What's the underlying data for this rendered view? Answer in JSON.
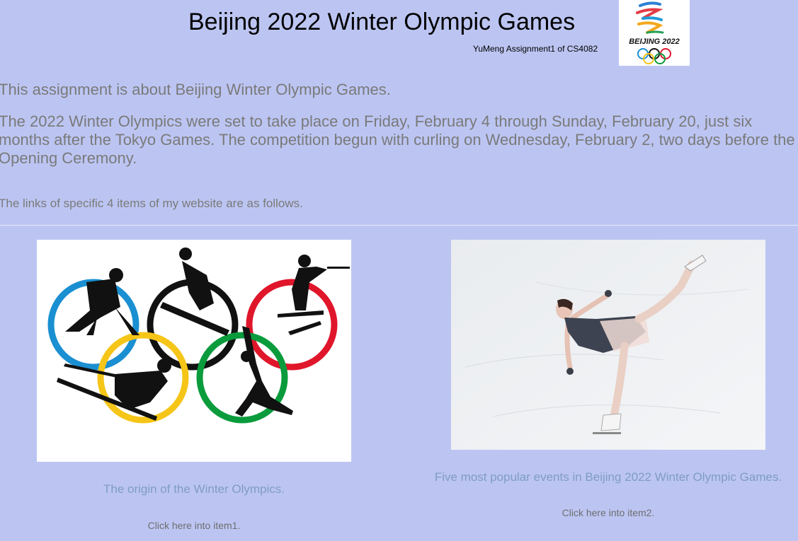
{
  "header": {
    "title": "Beijing 2022 Winter Olympic Games",
    "subtitle": "YuMeng Assignment1 of CS4082",
    "logo_text": "BEIJING 2022"
  },
  "intro": "This assignment is about Beijing Winter Olympic Games.",
  "description": "The 2022 Winter Olympics were set to take place on Friday, February 4 through Sunday, February 20, just six months after the Tokyo Games. The competition begun with curling on Wednesday, February 2, two days before the Opening Ceremony.",
  "links_intro": "The links of specific 4 items of my website are as follows.",
  "items": [
    {
      "title": "The origin of the Winter Olympics.",
      "link": "Click here into item1."
    },
    {
      "title": "Five most popular events in Beijing 2022 Winter Olympic Games.",
      "link": "Click here into item2."
    }
  ],
  "colors": {
    "background": "#bcc5f2",
    "body_text": "#7a7a7a",
    "item_title": "#7f9cc2",
    "ring_blue": "#1a8fd1",
    "ring_black": "#111111",
    "ring_red": "#e0162b",
    "ring_yellow": "#f5c518",
    "ring_green": "#0a9b3c"
  }
}
